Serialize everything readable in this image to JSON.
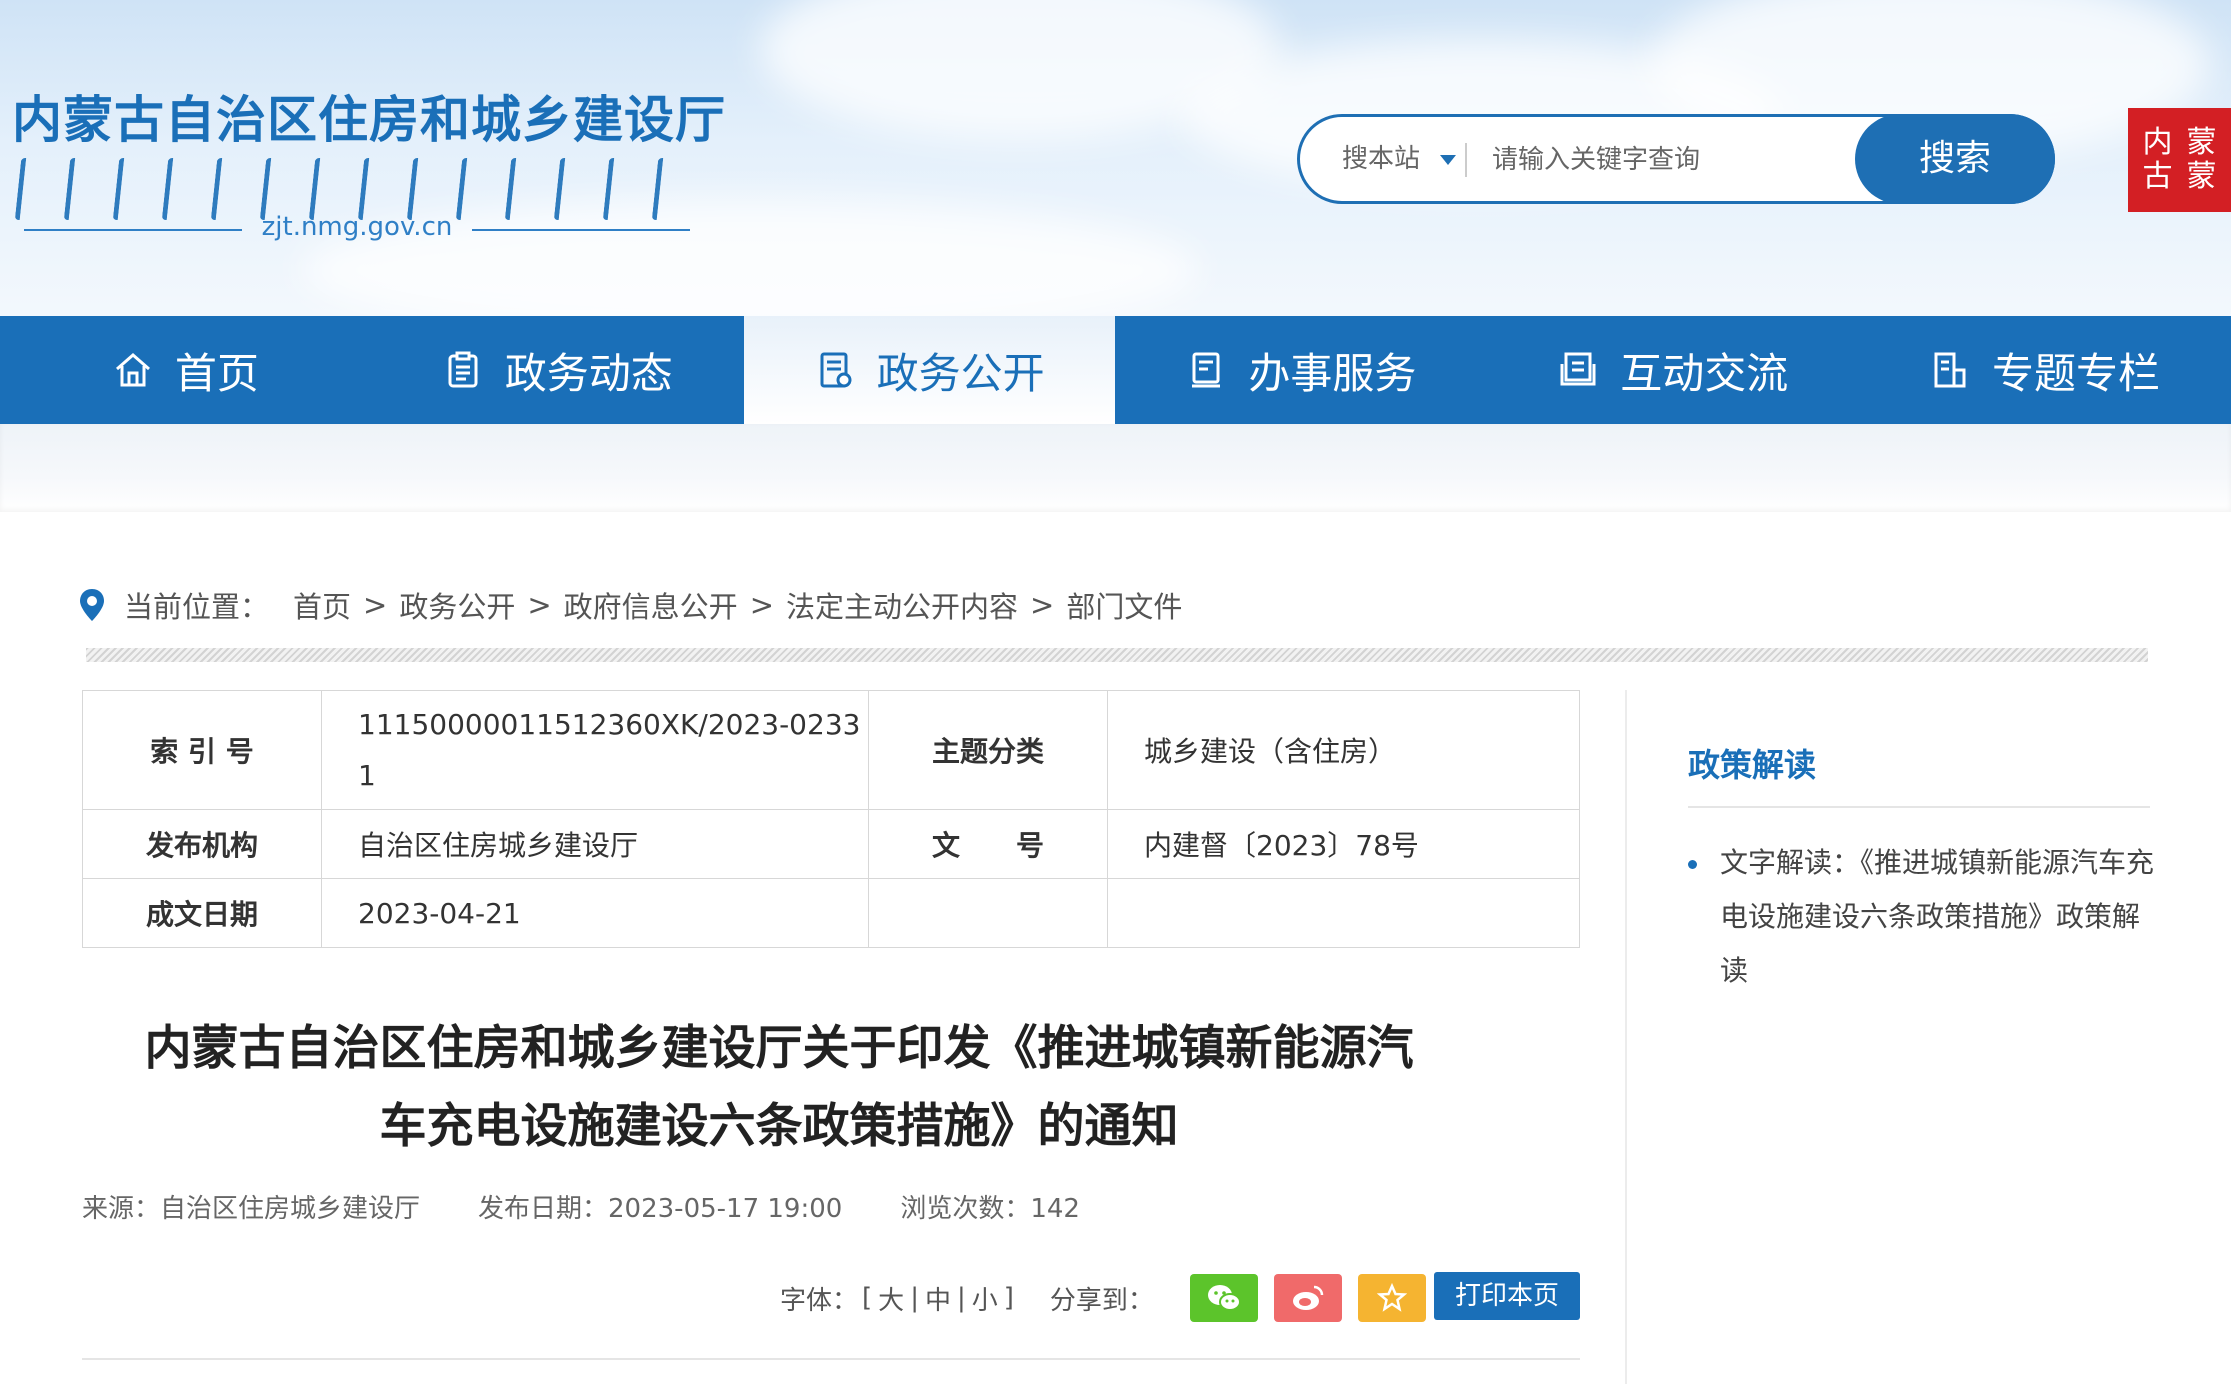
{
  "header": {
    "site_title": "内蒙古自治区住房和城乡建设厅",
    "domain": "zjt.nmg.gov.cn",
    "search": {
      "scope_label": "搜本站",
      "placeholder": "请输入关键字查询",
      "button_label": "搜索"
    },
    "seal_text": [
      "内",
      "蒙",
      "古",
      "蒙"
    ]
  },
  "nav": {
    "items": [
      {
        "label": "首页",
        "icon": "home-icon"
      },
      {
        "label": "政务动态",
        "icon": "clipboard-icon"
      },
      {
        "label": "政务公开",
        "icon": "document-icon"
      },
      {
        "label": "办事服务",
        "icon": "form-icon"
      },
      {
        "label": "互动交流",
        "icon": "book-icon"
      },
      {
        "label": "专题专栏",
        "icon": "column-icon"
      }
    ],
    "active_index": 2
  },
  "breadcrumb": {
    "label": "当前位置：",
    "items": [
      "首页",
      "政务公开",
      "政府信息公开",
      "法定主动公开内容",
      "部门文件"
    ],
    "separator": ">"
  },
  "info_table": {
    "index_no_label": "索 引 号",
    "index_no_value": "11150000011512360XK/2023-02331",
    "topic_label": "主题分类",
    "topic_value": "城乡建设（含住房）",
    "publisher_label": "发布机构",
    "publisher_value": "自治区住房城乡建设厅",
    "doc_no_label": "文　　号",
    "doc_no_value": "内建督〔2023〕78号",
    "date_label": "成文日期",
    "date_value": "2023-04-21"
  },
  "article": {
    "title_line1": "内蒙古自治区住房和城乡建设厅关于印发《推进城镇新能源汽",
    "title_line2": "车充电设施建设六条政策措施》的通知",
    "source": "来源：自治区住房城乡建设厅",
    "publish_date": "发布日期：2023-05-17 19:00",
    "views": "浏览次数：142"
  },
  "tools": {
    "font_label": "字体：",
    "font_open": "[",
    "font_large": "大",
    "font_medium": "中",
    "font_small": "小",
    "font_close": "]",
    "share_label": "分享到：",
    "print_label": "打印本页",
    "colors": {
      "wechat": "#5cc42b",
      "weibo": "#f06a6a",
      "favorite": "#f5b431"
    }
  },
  "sidebar": {
    "title": "政策解读",
    "items": [
      "文字解读：《推进城镇新能源汽车充电设施建设六条政策措施》政策解读"
    ]
  },
  "colors": {
    "brand_blue": "#1a6fb8",
    "seal_red": "#d31f24"
  }
}
